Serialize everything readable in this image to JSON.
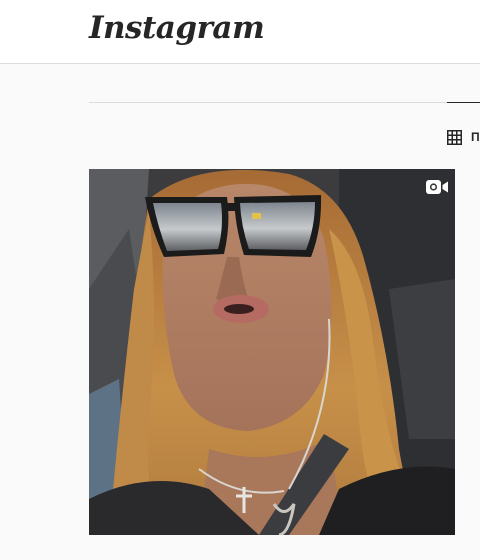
{
  "header": {
    "logo_text": "Instagram"
  },
  "tabs": [
    {
      "label": "ПУБЛИКАЦИИ",
      "icon": "grid-icon",
      "active": true
    }
  ],
  "posts": [
    {
      "type": "video",
      "badge_icon": "video-camera-icon",
      "alt": "Woman with sunglasses in a car"
    }
  ],
  "colors": {
    "background": "#fafafa",
    "header_bg": "#ffffff",
    "border": "#dbdbdb",
    "text": "#262626"
  }
}
